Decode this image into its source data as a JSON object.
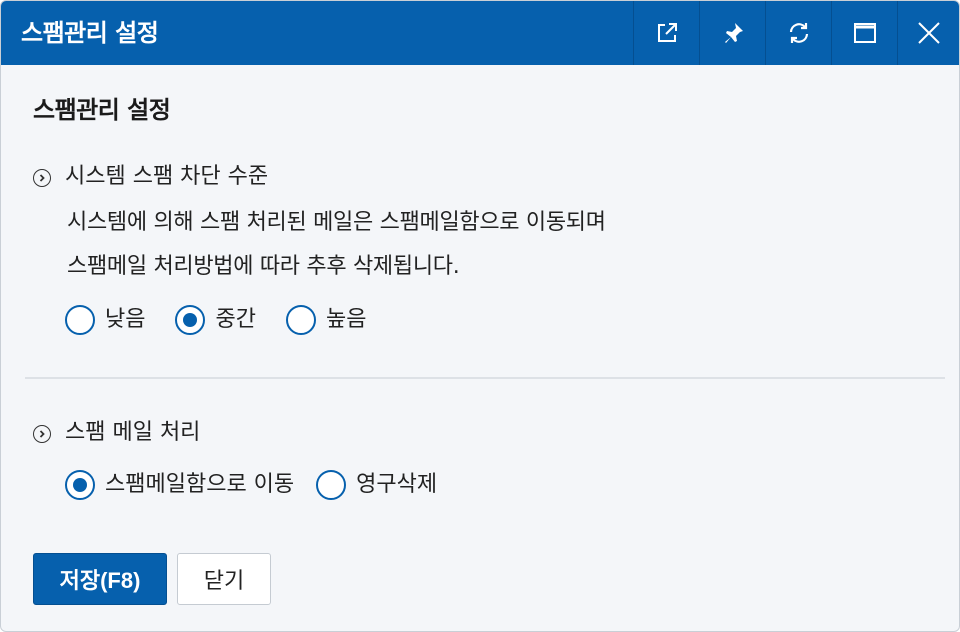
{
  "window": {
    "title": "스팸관리 설정",
    "controls": [
      "external-link-icon",
      "pin-icon",
      "refresh-icon",
      "maximize-icon",
      "close-icon"
    ]
  },
  "colors": {
    "accent": "#0660ad",
    "background": "#f4f6f9"
  },
  "main": {
    "heading": "스팸관리 설정",
    "spam_level": {
      "title": "시스템 스팸 차단 수준",
      "description_line1": "시스템에 의해 스팸 처리된 메일은 스팸메일함으로 이동되며",
      "description_line2": "스팸메일 처리방법에 따라 추후 삭제됩니다.",
      "options": [
        {
          "label": "낮음",
          "selected": false
        },
        {
          "label": "중간",
          "selected": true
        },
        {
          "label": "높음",
          "selected": false
        }
      ]
    },
    "spam_handling": {
      "title": "스팸 메일 처리",
      "options": [
        {
          "label": "스팸메일함으로 이동",
          "selected": true
        },
        {
          "label": "영구삭제",
          "selected": false
        }
      ]
    }
  },
  "footer": {
    "save_label": "저장(F8)",
    "close_label": "닫기"
  }
}
